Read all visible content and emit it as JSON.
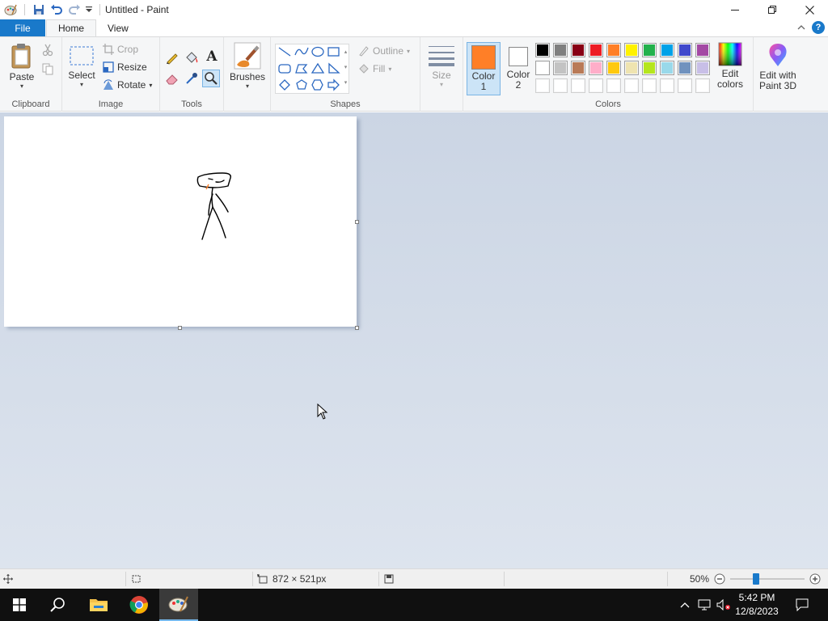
{
  "window": {
    "title": "Untitled - Paint",
    "minimize_icon": "minimize-icon",
    "maximize_icon": "restore-icon",
    "close_icon": "close-icon"
  },
  "tabs": {
    "file": "File",
    "home": "Home",
    "view": "View"
  },
  "clipboard": {
    "paste": "Paste",
    "group_label": "Clipboard"
  },
  "image": {
    "select": "Select",
    "crop": "Crop",
    "resize": "Resize",
    "rotate": "Rotate",
    "group_label": "Image"
  },
  "tools": {
    "group_label": "Tools"
  },
  "brushes": {
    "label": "Brushes"
  },
  "shapes": {
    "outline": "Outline",
    "fill": "Fill",
    "group_label": "Shapes"
  },
  "size": {
    "label": "Size"
  },
  "colors": {
    "color1_line1": "Color",
    "color1_line2": "1",
    "color2_line1": "Color",
    "color2_line2": "2",
    "color1_value": "#ff7f27",
    "color2_value": "#ffffff",
    "edit_line1": "Edit",
    "edit_line2": "colors",
    "paint3d_line1": "Edit with",
    "paint3d_line2": "Paint 3D",
    "group_label": "Colors",
    "palette_row1": [
      "#000000",
      "#7f7f7f",
      "#880015",
      "#ed1c24",
      "#ff7f27",
      "#fff200",
      "#22b14c",
      "#00a2e8",
      "#3f48cc",
      "#a349a4"
    ],
    "palette_row2": [
      "#ffffff",
      "#c3c3c3",
      "#b97a57",
      "#ffaec9",
      "#ffc90e",
      "#efe4b0",
      "#b5e61d",
      "#99d9ea",
      "#7092be",
      "#c8bfe7"
    ]
  },
  "status": {
    "dimensions": "872 × 521px",
    "zoom": "50%",
    "zoom_fraction": 0.5
  },
  "taskbar": {
    "time": "5:42 PM",
    "date": "12/8/2023"
  }
}
